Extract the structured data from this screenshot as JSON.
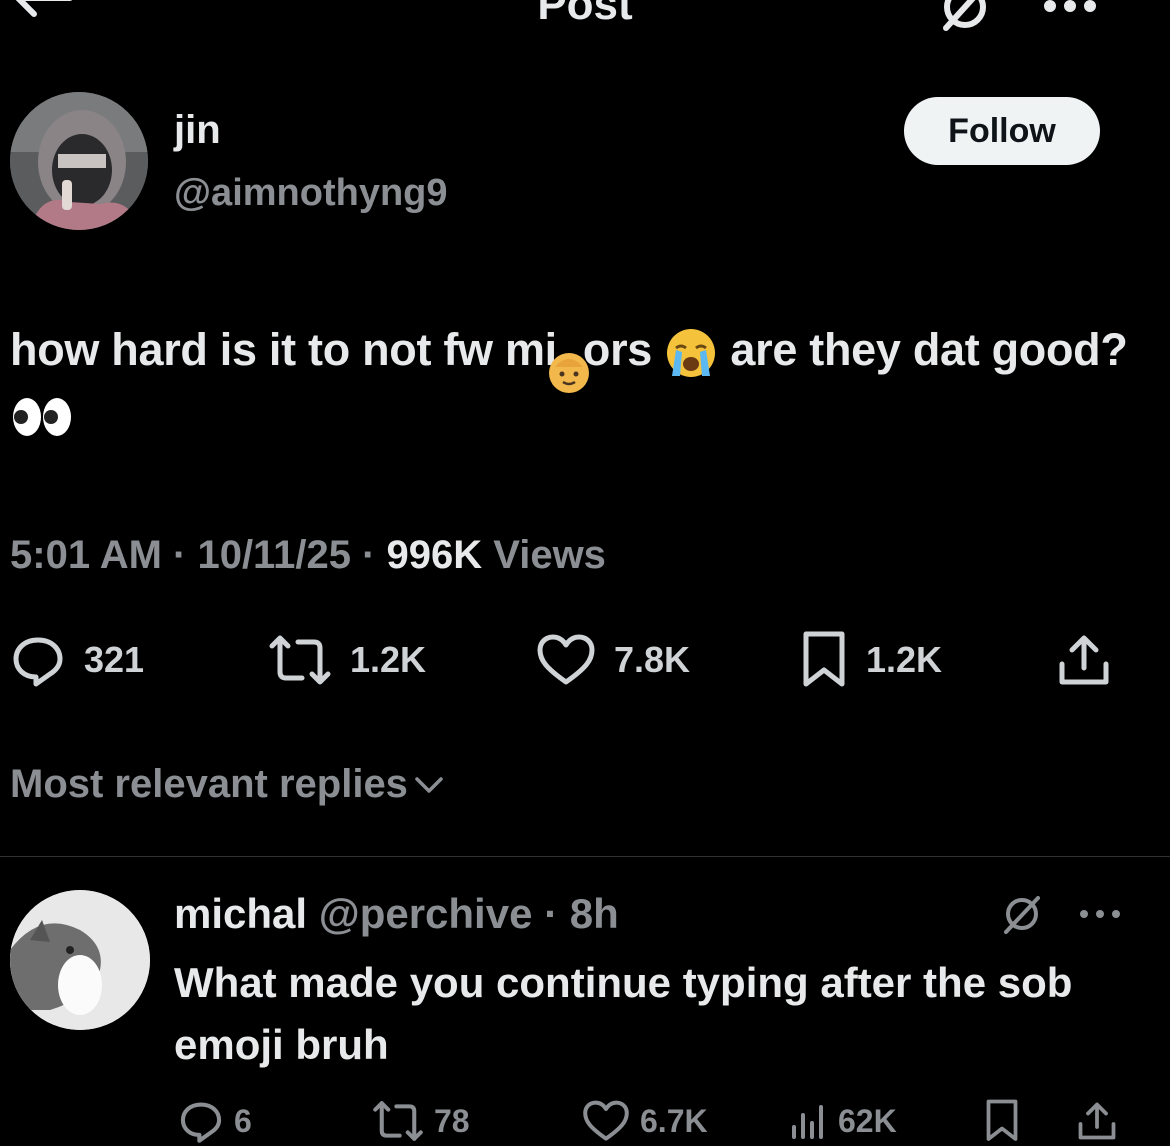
{
  "header": {
    "title": "Post",
    "icons": {
      "back": "back-arrow-icon",
      "grok": "grok-icon",
      "more": "more-icon"
    }
  },
  "post": {
    "author": {
      "name": "jin",
      "handle": "@aimnothyng9",
      "avatar": "avatar"
    },
    "follow_label": "Follow",
    "text_part1": "how hard is it to not fw mi",
    "text_part2": "ors ",
    "text_part3": " are they dat good? ",
    "emojis": [
      "baby-emoji",
      "crying-face-emoji",
      "eyes-emoji"
    ],
    "meta": {
      "time": "5:01 AM",
      "date": "10/11/25",
      "views_count": "996K",
      "views_label": "Views",
      "separator": " · "
    },
    "actions": {
      "replies": "321",
      "reposts": "1.2K",
      "likes": "7.8K",
      "bookmarks": "1.2K"
    }
  },
  "replies_section": {
    "sort_label": "Most relevant replies"
  },
  "reply": {
    "name": "michal",
    "handle": "@perchive",
    "time": "8h",
    "separator": " · ",
    "text": "What made you continue typing after the sob emoji bruh",
    "actions": {
      "replies": "6",
      "reposts": "78",
      "likes": "6.7K",
      "views": "62K"
    }
  },
  "colors": {
    "background": "#000000",
    "text": "#e7e9ea",
    "secondary": "#8b8f93",
    "follow_bg": "#eff3f4",
    "divider": "#2f3336"
  }
}
